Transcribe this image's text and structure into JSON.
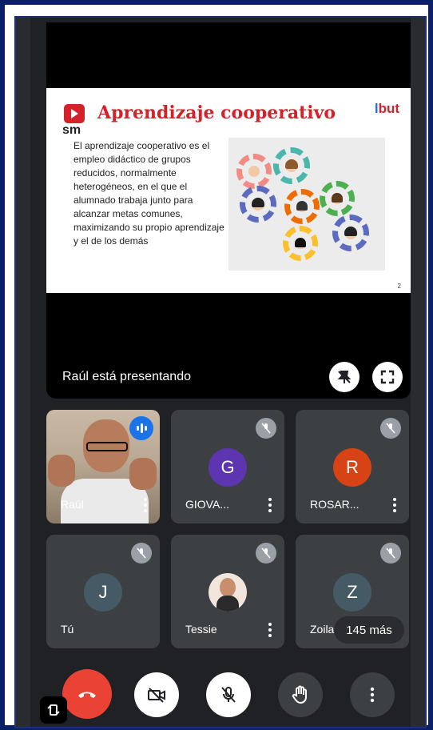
{
  "slide": {
    "title": "Aprendizaje cooperativo",
    "logo_text": "sm",
    "brand_l": "l",
    "brand_but": "but",
    "paragraph": "El aprendizaje cooperativo es el empleo didáctico de grupos reducidos, normalmente heterogéneos, en el que el alumnado trabaja junto para alcanzar metas comunes, maximizando su propio aprendizaje y el de los demás",
    "page_number": "2"
  },
  "presenting_label": "Raúl está presentando",
  "participants": [
    {
      "name": "Raúl",
      "speaking": true
    },
    {
      "name": "GIOVA...",
      "initial": "G",
      "color": "#5e35b1",
      "muted": true
    },
    {
      "name": "ROSAR...",
      "initial": "R",
      "color": "#d84315",
      "muted": true
    },
    {
      "name": "Tú",
      "initial": "J",
      "color": "#455a64",
      "muted": true
    },
    {
      "name": "Tessie",
      "muted": true
    },
    {
      "name": "Zoila",
      "initial": "Z",
      "color": "#455a64",
      "muted": true
    }
  ],
  "more_count": "145 más",
  "controls": [
    {
      "icon": "end-call-icon",
      "color": "#ea4335"
    },
    {
      "icon": "camera-off-icon",
      "color": "#ffffff"
    },
    {
      "icon": "mic-off-icon",
      "color": "#ffffff"
    },
    {
      "icon": "raise-hand-icon",
      "color": "#3c4043"
    },
    {
      "icon": "more-vert-icon",
      "color": "#3c4043"
    }
  ],
  "colors": {
    "background": "#202124",
    "tile": "#3c4043",
    "accent_red": "#d4212a",
    "speaking_blue": "#1a73e8"
  }
}
